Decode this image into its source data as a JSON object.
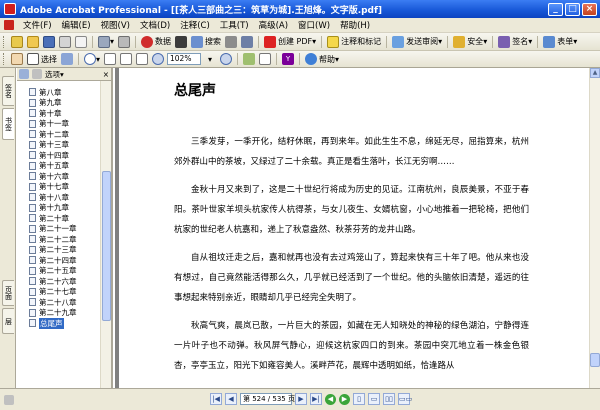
{
  "window": {
    "title": "Adobe Acrobat Professional - [[茶人三部曲之三：筑草为城].王旭烽。文字版.pdf]",
    "min": "_",
    "max": "□",
    "close": "×"
  },
  "menu": [
    "文件(F)",
    "编辑(E)",
    "视图(V)",
    "文档(D)",
    "注释(C)",
    "工具(T)",
    "高级(A)",
    "窗口(W)",
    "帮助(H)"
  ],
  "toolbar1": {
    "secure_label": "数据",
    "search_label": "搜索",
    "create_pdf_label": "创建 PDF",
    "comment_label": "注释和标记",
    "review_label": "发送审阅",
    "security_label": "安全",
    "sign_label": "签名",
    "forms_label": "表单"
  },
  "toolbar2": {
    "select_label": "选择",
    "zoom_value": "102%",
    "help_label": "帮助"
  },
  "sidetabs": [
    "签名",
    "书签",
    "页面",
    "层"
  ],
  "navpanel": {
    "options_label": "选项",
    "items": [
      {
        "label": "第八章"
      },
      {
        "label": "第九章"
      },
      {
        "label": "第十章"
      },
      {
        "label": "第十一章"
      },
      {
        "label": "第十二章"
      },
      {
        "label": "第十三章"
      },
      {
        "label": "第十四章"
      },
      {
        "label": "第十五章"
      },
      {
        "label": "第十六章"
      },
      {
        "label": "第十七章"
      },
      {
        "label": "第十八章"
      },
      {
        "label": "第十九章"
      },
      {
        "label": "第二十章"
      },
      {
        "label": "第二十一章"
      },
      {
        "label": "第二十二章"
      },
      {
        "label": "第二十三章"
      },
      {
        "label": "第二十四章"
      },
      {
        "label": "第二十五章"
      },
      {
        "label": "第二十六章"
      },
      {
        "label": "第二十七章"
      },
      {
        "label": "第二十八章"
      },
      {
        "label": "第二十九章"
      },
      {
        "label": "总尾声"
      }
    ]
  },
  "document": {
    "chapter_title": "总尾声",
    "paragraphs": [
      "三季发芽，一季开化，结籽休眠，再到来年。如此生生不息，绵延无尽，屈指算来，杭州郊外群山中的茶坡，又绿过了二十余载。真正是看生落叶，长江无穷啊……",
      "金秋十月又来到了，这是二十世纪行将成为历史的见证。江南杭州，良辰美景，不亚于春阳。茶叶世家羊坝头杭家传人杭得茶，与女儿夜生、女婿杭窗，小心地推着一把轮椅，把他们杭家的世纪老人杭嘉和，递上了秋意盎然、秋茶芬芳的龙井山路。",
      "自从祖坟迁走之后，嘉和就再也没有去过鸡笼山了，算起来快有三十年了吧。他从来也没有想过，自己竟然能活得那么久，几乎就已经活到了一个世纪。他的头脑依旧清楚，遥远的往事想起来特别亲近，眼睛却几乎已经完全失明了。",
      "秋高气爽，晨岚已散，一片巨大的茶园，如藏在无人知晓处的神秘的绿色湖泊，宁静得连一片叶子也不动弹。秋风屏气静心，迎候这杭家四口的到来。茶园中突兀地立着一株金色银杏，亭亭玉立，阳光下如雍容美人。溪畔芦花，晨辉中透明如纸，恰逢路从"
    ]
  },
  "statusbar": {
    "page_field": "第 524 / 535 页"
  }
}
